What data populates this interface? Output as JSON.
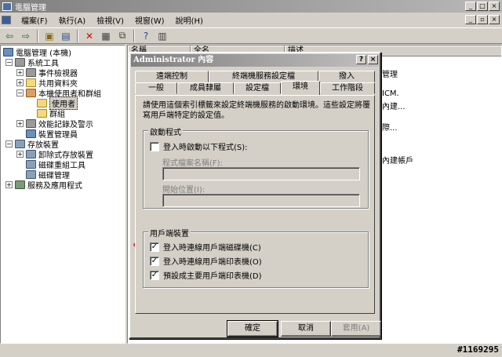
{
  "window": {
    "title": "電腦管理",
    "icon": "computer-management-icon"
  },
  "menubar": {
    "items": [
      "檔案(F)",
      "執行(A)",
      "檢視(V)",
      "視窗(W)",
      "說明(H)"
    ]
  },
  "toolbar": {
    "icons": [
      "back-icon",
      "forward-icon",
      "up-icon",
      "show-tree-icon",
      "delete-icon",
      "properties-icon",
      "export-icon",
      "help-icon",
      "console-icon"
    ]
  },
  "tree": {
    "root": "電腦管理 (本機)",
    "system_tools": "系統工具",
    "event_viewer": "事件檢視器",
    "shared_folders": "共用資料夾",
    "local_users": "本機使用者和群組",
    "users": "使用者",
    "groups": "群組",
    "perf_logs": "效能記錄及警示",
    "device_manager": "裝置管理員",
    "storage": "存放裝置",
    "removable": "卸除式存放裝置",
    "defrag": "磁碟重組工具",
    "disk_mgmt": "磁碟管理",
    "services": "服務及應用程式"
  },
  "list": {
    "headers": [
      "名稱",
      "全名",
      "描述"
    ],
    "bg_fragments": [
      "管理",
      "ICM.",
      "內建...",
      "際...",
      "內建帳戶"
    ]
  },
  "dialog": {
    "title": "Administrator 內容",
    "tabs_row1": [
      "遠端控制",
      "終端機服務設定檔",
      "撥入"
    ],
    "tabs_row2": [
      "一般",
      "成員隸屬",
      "設定檔",
      "環境",
      "工作階段"
    ],
    "description": "請使用這個索引標籤來設定終端機服務的啟動環境。這些設定將覆寫用戶端特定的設定值。",
    "startup_group": {
      "label": "啟動程式",
      "checkbox": {
        "label": "登入時啟動以下程式(S):",
        "checked": false
      },
      "program_label": "程式檔案名稱(F):",
      "program_value": "",
      "start_in_label": "開始位置(I):",
      "start_in_value": ""
    },
    "client_group": {
      "label": "用戶端裝置",
      "items": [
        {
          "label": "登入時連線用戶端磁碟機(C)",
          "checked": true
        },
        {
          "label": "登入時連線用戶端印表機(O)",
          "checked": true
        },
        {
          "label": "預設成主要用戶端印表機(D)",
          "checked": true
        }
      ]
    },
    "buttons": {
      "ok": "確定",
      "cancel": "取消",
      "apply": "套用(A)"
    }
  },
  "watermark": "#1169295",
  "colors": {
    "highlight_oval": "#d4343a",
    "title_gradient": "#808080"
  }
}
